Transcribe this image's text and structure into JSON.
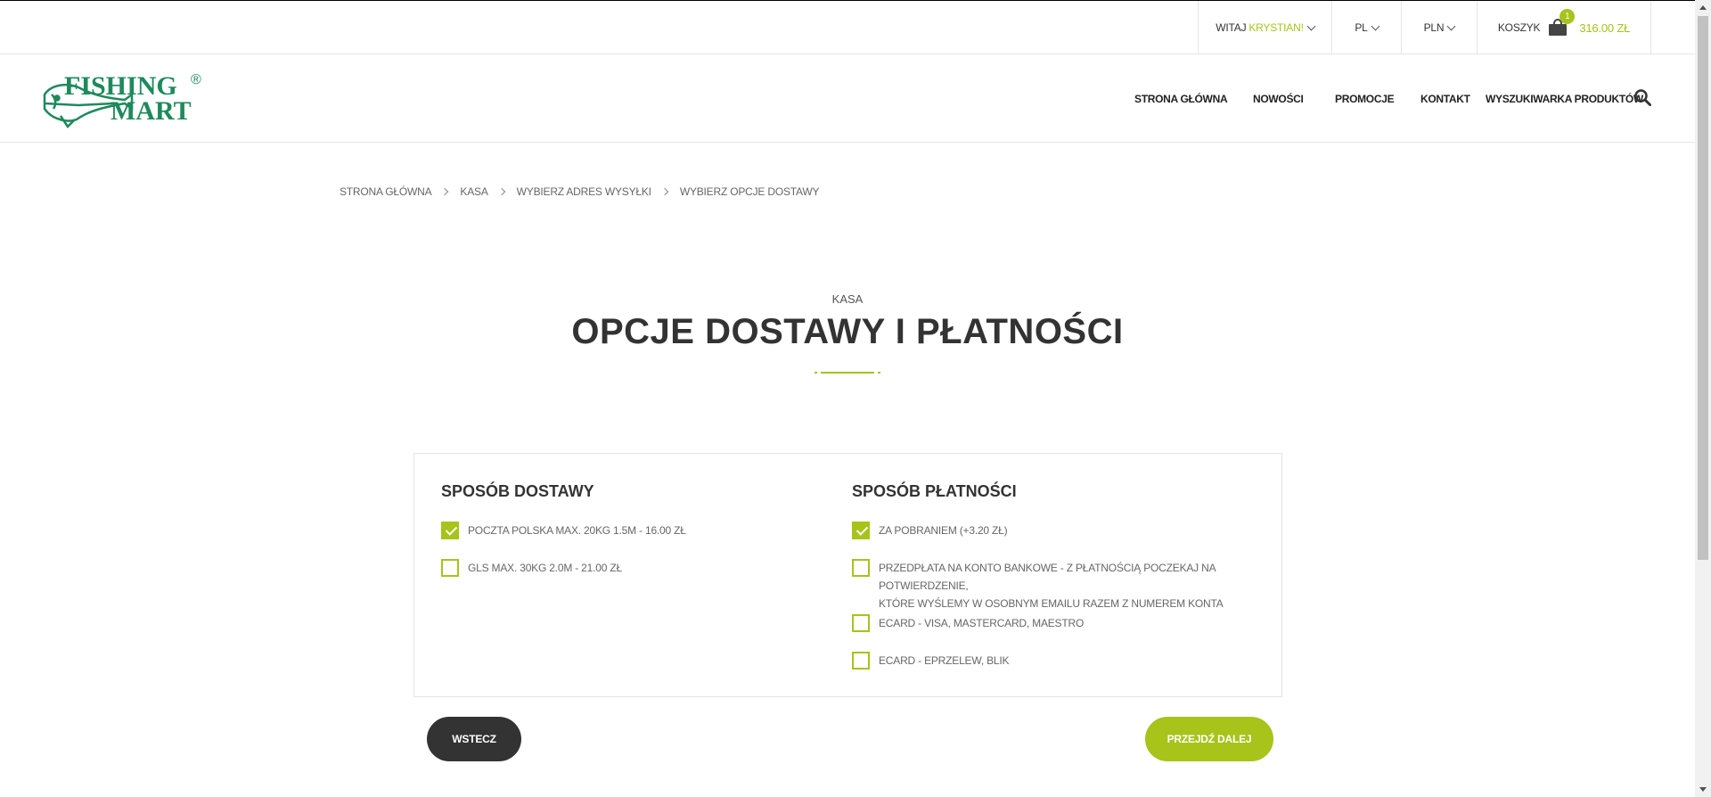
{
  "topbar": {
    "greeting": "WITAJ",
    "user_name": "KRYSTIAN!",
    "language": "PL",
    "currency": "PLN",
    "cart_label": "KOSZYK",
    "cart_count": "1",
    "cart_total": "316.00 ZŁ"
  },
  "logo": {
    "line1": "FISHING",
    "line2": "MART",
    "registered": "®"
  },
  "nav": {
    "items": [
      "STRONA GŁÓWNA",
      "NOWOŚCI",
      "PROMOCJE",
      "KONTAKT",
      "WYSZUKIWARKA PRODUKTÓW"
    ]
  },
  "breadcrumb": [
    "STRONA GŁÓWNA",
    "KASA",
    "WYBIERZ ADRES WYSYŁKI",
    "WYBIERZ OPCJE DOSTAWY"
  ],
  "page": {
    "kicker": "KASA",
    "title": "OPCJE DOSTAWY I PŁATNOŚCI"
  },
  "delivery": {
    "title": "SPOSÓB DOSTAWY",
    "options": [
      {
        "label": "POCZTA POLSKA MAX. 20KG 1.5M - 16.00 ZŁ",
        "checked": true
      },
      {
        "label": "GLS MAX. 30KG 2.0M - 21.00 ZŁ",
        "checked": false
      }
    ]
  },
  "payment": {
    "title": "SPOSÓB PŁATNOŚCI",
    "options": [
      {
        "label": "ZA POBRANIEM (+3.20 ZŁ)",
        "checked": true
      },
      {
        "label_line1": "PRZEDPŁATA NA KONTO BANKOWE - Z PŁATNOŚCIĄ POCZEKAJ NA POTWIERDZENIE,",
        "label_line2": "KTÓRE WYŚLEMY W OSOBNYM EMAILU RAZEM Z NUMEREM KONTA",
        "checked": false
      },
      {
        "label": "ECARD - VISA, MASTERCARD, MAESTRO",
        "checked": false
      },
      {
        "label": "ECARD - EPRZELEW, BLIK",
        "checked": false
      }
    ]
  },
  "buttons": {
    "back": "WSTECZ",
    "next": "PRZEJDŹ DALEJ"
  },
  "colors": {
    "accent": "#a8c31a",
    "dark": "#333333",
    "logo_green": "#1e8a5c"
  }
}
